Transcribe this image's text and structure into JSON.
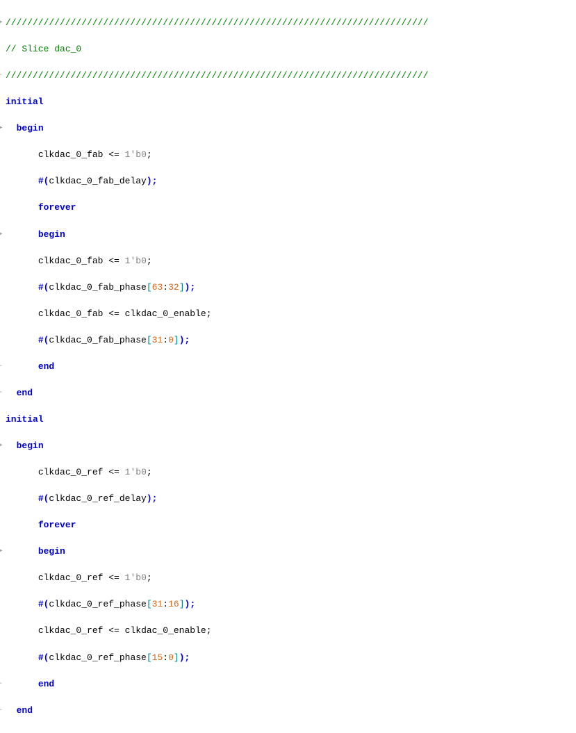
{
  "comment": {
    "rule": "//////////////////////////////////////////////////////////////////////////////",
    "title": "// Slice dac_0"
  },
  "block1": {
    "kw_initial": "initial",
    "kw_begin": "begin",
    "sig_fab": "clkdac_0_fab",
    "op_le": "<=",
    "lit_1b0": "1'b0",
    "semi": ";",
    "hash_open": "#(",
    "fab_delay": "clkdac_0_fab_delay",
    "close_semi": ");",
    "kw_forever": "forever",
    "kw_begin2": "begin",
    "fab_phase": "clkdac_0_fab_phase",
    "br_open": "[",
    "idx_63": "63",
    "colon": ":",
    "idx_32": "32",
    "br_close": "]",
    "enable": "clkdac_0_enable",
    "idx_31": "31",
    "idx_0": "0",
    "kw_end": "end",
    "kw_end2": "end"
  },
  "block2": {
    "kw_initial": "initial",
    "kw_begin": "begin",
    "sig_ref": "clkdac_0_ref",
    "op_le": "<=",
    "lit_1b0": "1'b0",
    "semi": ";",
    "hash_open": "#(",
    "ref_delay": "clkdac_0_ref_delay",
    "close_semi": ");",
    "kw_forever": "forever",
    "kw_begin2": "begin",
    "ref_phase": "clkdac_0_ref_phase",
    "br_open": "[",
    "idx_31": "31",
    "colon": ":",
    "idx_16": "16",
    "br_close": "]",
    "enable": "clkdac_0_enable",
    "idx_15": "15",
    "idx_0": "0",
    "kw_end": "end",
    "kw_end2": "end"
  }
}
